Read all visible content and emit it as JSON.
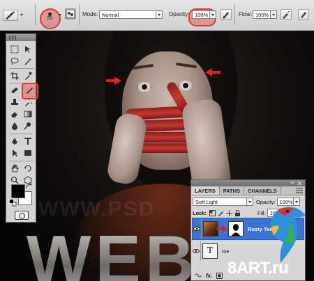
{
  "options_bar": {
    "brush_size": "25",
    "mode_label": "Mode:",
    "mode_value": "Normal",
    "opacity_label": "Opacity:",
    "opacity_value": "100%",
    "flow_label": "Flow:",
    "flow_value": "100%",
    "highlight_color": "#d93a3a"
  },
  "canvas": {
    "watermark_text": "WWW.PSD",
    "big_text": "WEB"
  },
  "tools": {
    "icons": [
      "marquee-icon",
      "move-icon",
      "lasso-icon",
      "magic-wand-icon",
      "crop-icon",
      "eyedropper-icon",
      "healing-icon",
      "brush-icon",
      "stamp-icon",
      "history-brush-icon",
      "eraser-icon",
      "gradient-icon",
      "blur-icon",
      "dodge-icon",
      "pen-icon",
      "type-icon",
      "path-select-icon",
      "shape-icon",
      "hand-icon",
      "rotate-icon",
      "zoom-icon",
      "3d-icon"
    ],
    "active_tool": "brush-icon",
    "foreground_color": "#000000",
    "background_color": "#ffffff"
  },
  "layers": {
    "tabs": [
      "LAYERS",
      "PATHS",
      "CHANNELS"
    ],
    "blend_mode": "Soft Light",
    "opacity_label": "Opacity:",
    "opacity_value": "100%",
    "lock_label": "Lock:",
    "fill_label": "Fill:",
    "fill_value": "100%",
    "items": [
      {
        "name": "Rusty Texture",
        "selected": true
      },
      {
        "name": "me",
        "selected": false
      }
    ],
    "selected_color": "#3a73d6"
  },
  "branding": {
    "site_logo": "8ART.ru"
  }
}
